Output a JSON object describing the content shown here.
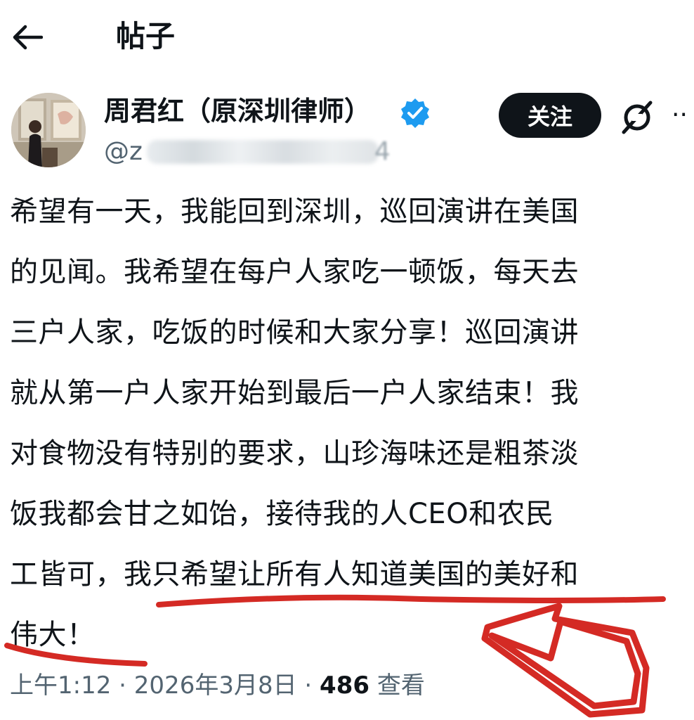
{
  "header": {
    "back_icon": "arrow-left-icon",
    "title": "帖子"
  },
  "author": {
    "name": "周君红（原深圳律师）",
    "handle_prefix": "@z",
    "handle_suffix": "4",
    "verified_icon": "verified-badge-icon",
    "verified_color": "#1d9bf0"
  },
  "actions": {
    "follow_label": "关注",
    "grok_icon": "grok-icon",
    "more_label": "··"
  },
  "post": {
    "text": "希望有一天，我能回到深圳，巡回演讲在美国\n的见闻。我希望在每户人家吃一顿饭，每天去\n三户人家，吃饭的时候和大家分享！巡回演讲\n就从第一户人家开始到最后一户人家结束！我\n对食物没有特别的要求，山珍海味还是粗茶淡\n饭我都会甘之如饴，接待我的人CEO和农民\n工皆可，我只希望让所有人知道美国的美好和\n伟大！"
  },
  "meta": {
    "time": "上午1:12",
    "separator": " · ",
    "date": "2026年3月8日",
    "views": "486",
    "views_label": "查看"
  },
  "annotation": {
    "color": "#d42a24"
  }
}
